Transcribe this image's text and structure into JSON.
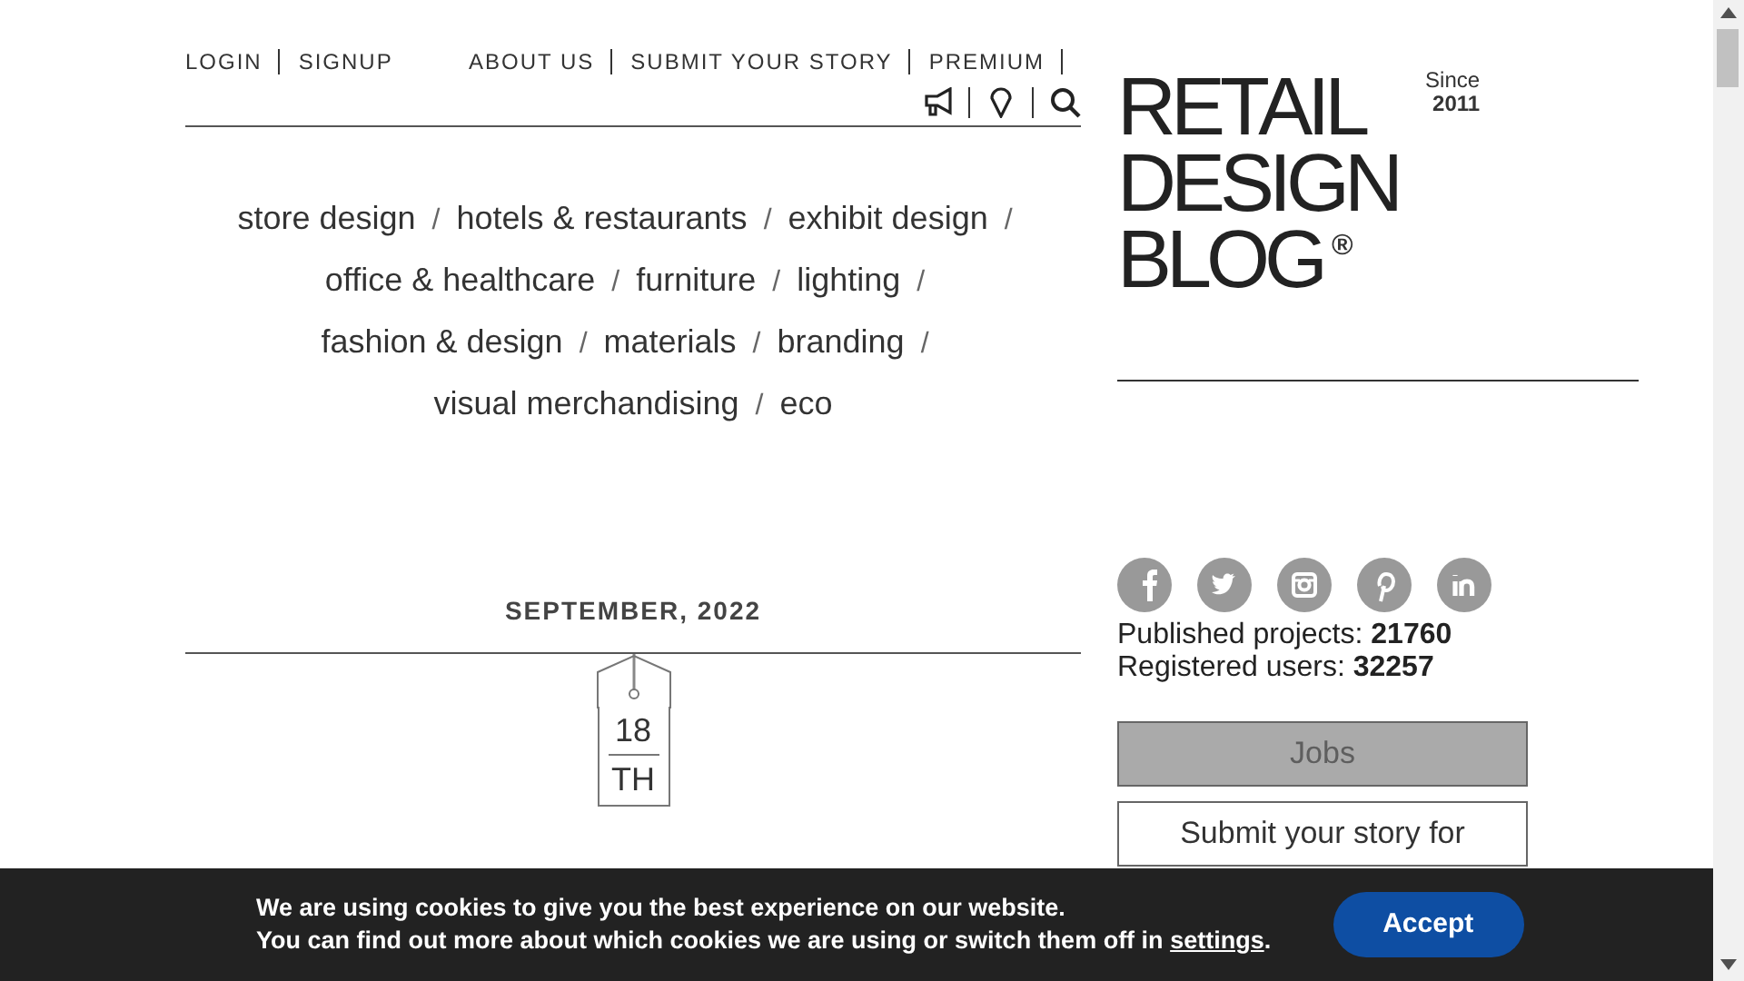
{
  "header": {
    "left_links": [
      "LOGIN",
      "SIGNUP"
    ],
    "right_links": [
      "ABOUT US",
      "SUBMIT YOUR STORY",
      "PREMIUM"
    ]
  },
  "categories": [
    [
      {
        "label": "store design",
        "separator": "/"
      },
      {
        "label": "hotels & restaurants",
        "separator": "/"
      },
      {
        "label": "exhibit design",
        "separator": "/"
      }
    ],
    [
      {
        "label": "office & healthcare",
        "separator": "/"
      },
      {
        "label": "furniture",
        "separator": "/"
      },
      {
        "label": "lighting",
        "separator": "/"
      }
    ],
    [
      {
        "label": "fashion & design",
        "separator": "/"
      },
      {
        "label": "materials",
        "separator": "/"
      },
      {
        "label": "branding",
        "separator": "/"
      }
    ],
    [
      {
        "label": "visual merchandising",
        "separator": "/"
      },
      {
        "label": "eco"
      }
    ]
  ],
  "date": {
    "month": "SEPTEMBER, 2022",
    "day": "18",
    "suffix": "TH"
  },
  "logo": {
    "lines": [
      "RETAIL",
      "DESIGN",
      "BLOG"
    ],
    "registered": "®",
    "since_label": "Since",
    "since_year": "2011"
  },
  "social": [
    {
      "kind": "facebook"
    },
    {
      "kind": "twitter"
    },
    {
      "kind": "instagram"
    },
    {
      "kind": "pinterest"
    },
    {
      "kind": "linkedin"
    }
  ],
  "stats": [
    "Published projects: **21760**",
    "Registered users: **32257**"
  ],
  "sidebar_buttons": [
    {
      "label": "Jobs",
      "disabled": true
    },
    {
      "label": "Submit your story for",
      "disabled": false
    }
  ],
  "cookie_bar": {
    "line1": "We are using cookies to give you the best experience on our website.",
    "line2_before": "You can find out more about which cookies we are using or switch them off in",
    "link": "settings",
    "line2_after": ".",
    "button": "Accept"
  }
}
